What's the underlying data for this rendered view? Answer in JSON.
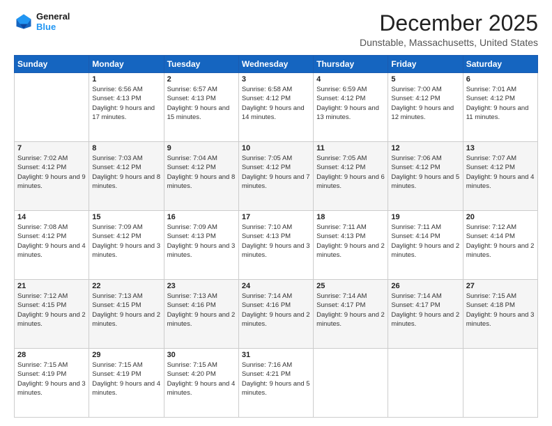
{
  "logo": {
    "line1": "General",
    "line2": "Blue"
  },
  "title": "December 2025",
  "location": "Dunstable, Massachusetts, United States",
  "header": {
    "days": [
      "Sunday",
      "Monday",
      "Tuesday",
      "Wednesday",
      "Thursday",
      "Friday",
      "Saturday"
    ]
  },
  "weeks": [
    [
      {
        "day": "",
        "sunrise": "",
        "sunset": "",
        "daylight": ""
      },
      {
        "day": "1",
        "sunrise": "Sunrise: 6:56 AM",
        "sunset": "Sunset: 4:13 PM",
        "daylight": "Daylight: 9 hours and 17 minutes."
      },
      {
        "day": "2",
        "sunrise": "Sunrise: 6:57 AM",
        "sunset": "Sunset: 4:13 PM",
        "daylight": "Daylight: 9 hours and 15 minutes."
      },
      {
        "day": "3",
        "sunrise": "Sunrise: 6:58 AM",
        "sunset": "Sunset: 4:12 PM",
        "daylight": "Daylight: 9 hours and 14 minutes."
      },
      {
        "day": "4",
        "sunrise": "Sunrise: 6:59 AM",
        "sunset": "Sunset: 4:12 PM",
        "daylight": "Daylight: 9 hours and 13 minutes."
      },
      {
        "day": "5",
        "sunrise": "Sunrise: 7:00 AM",
        "sunset": "Sunset: 4:12 PM",
        "daylight": "Daylight: 9 hours and 12 minutes."
      },
      {
        "day": "6",
        "sunrise": "Sunrise: 7:01 AM",
        "sunset": "Sunset: 4:12 PM",
        "daylight": "Daylight: 9 hours and 11 minutes."
      }
    ],
    [
      {
        "day": "7",
        "sunrise": "Sunrise: 7:02 AM",
        "sunset": "Sunset: 4:12 PM",
        "daylight": "Daylight: 9 hours and 9 minutes."
      },
      {
        "day": "8",
        "sunrise": "Sunrise: 7:03 AM",
        "sunset": "Sunset: 4:12 PM",
        "daylight": "Daylight: 9 hours and 8 minutes."
      },
      {
        "day": "9",
        "sunrise": "Sunrise: 7:04 AM",
        "sunset": "Sunset: 4:12 PM",
        "daylight": "Daylight: 9 hours and 8 minutes."
      },
      {
        "day": "10",
        "sunrise": "Sunrise: 7:05 AM",
        "sunset": "Sunset: 4:12 PM",
        "daylight": "Daylight: 9 hours and 7 minutes."
      },
      {
        "day": "11",
        "sunrise": "Sunrise: 7:05 AM",
        "sunset": "Sunset: 4:12 PM",
        "daylight": "Daylight: 9 hours and 6 minutes."
      },
      {
        "day": "12",
        "sunrise": "Sunrise: 7:06 AM",
        "sunset": "Sunset: 4:12 PM",
        "daylight": "Daylight: 9 hours and 5 minutes."
      },
      {
        "day": "13",
        "sunrise": "Sunrise: 7:07 AM",
        "sunset": "Sunset: 4:12 PM",
        "daylight": "Daylight: 9 hours and 4 minutes."
      }
    ],
    [
      {
        "day": "14",
        "sunrise": "Sunrise: 7:08 AM",
        "sunset": "Sunset: 4:12 PM",
        "daylight": "Daylight: 9 hours and 4 minutes."
      },
      {
        "day": "15",
        "sunrise": "Sunrise: 7:09 AM",
        "sunset": "Sunset: 4:12 PM",
        "daylight": "Daylight: 9 hours and 3 minutes."
      },
      {
        "day": "16",
        "sunrise": "Sunrise: 7:09 AM",
        "sunset": "Sunset: 4:13 PM",
        "daylight": "Daylight: 9 hours and 3 minutes."
      },
      {
        "day": "17",
        "sunrise": "Sunrise: 7:10 AM",
        "sunset": "Sunset: 4:13 PM",
        "daylight": "Daylight: 9 hours and 3 minutes."
      },
      {
        "day": "18",
        "sunrise": "Sunrise: 7:11 AM",
        "sunset": "Sunset: 4:13 PM",
        "daylight": "Daylight: 9 hours and 2 minutes."
      },
      {
        "day": "19",
        "sunrise": "Sunrise: 7:11 AM",
        "sunset": "Sunset: 4:14 PM",
        "daylight": "Daylight: 9 hours and 2 minutes."
      },
      {
        "day": "20",
        "sunrise": "Sunrise: 7:12 AM",
        "sunset": "Sunset: 4:14 PM",
        "daylight": "Daylight: 9 hours and 2 minutes."
      }
    ],
    [
      {
        "day": "21",
        "sunrise": "Sunrise: 7:12 AM",
        "sunset": "Sunset: 4:15 PM",
        "daylight": "Daylight: 9 hours and 2 minutes."
      },
      {
        "day": "22",
        "sunrise": "Sunrise: 7:13 AM",
        "sunset": "Sunset: 4:15 PM",
        "daylight": "Daylight: 9 hours and 2 minutes."
      },
      {
        "day": "23",
        "sunrise": "Sunrise: 7:13 AM",
        "sunset": "Sunset: 4:16 PM",
        "daylight": "Daylight: 9 hours and 2 minutes."
      },
      {
        "day": "24",
        "sunrise": "Sunrise: 7:14 AM",
        "sunset": "Sunset: 4:16 PM",
        "daylight": "Daylight: 9 hours and 2 minutes."
      },
      {
        "day": "25",
        "sunrise": "Sunrise: 7:14 AM",
        "sunset": "Sunset: 4:17 PM",
        "daylight": "Daylight: 9 hours and 2 minutes."
      },
      {
        "day": "26",
        "sunrise": "Sunrise: 7:14 AM",
        "sunset": "Sunset: 4:17 PM",
        "daylight": "Daylight: 9 hours and 2 minutes."
      },
      {
        "day": "27",
        "sunrise": "Sunrise: 7:15 AM",
        "sunset": "Sunset: 4:18 PM",
        "daylight": "Daylight: 9 hours and 3 minutes."
      }
    ],
    [
      {
        "day": "28",
        "sunrise": "Sunrise: 7:15 AM",
        "sunset": "Sunset: 4:19 PM",
        "daylight": "Daylight: 9 hours and 3 minutes."
      },
      {
        "day": "29",
        "sunrise": "Sunrise: 7:15 AM",
        "sunset": "Sunset: 4:19 PM",
        "daylight": "Daylight: 9 hours and 4 minutes."
      },
      {
        "day": "30",
        "sunrise": "Sunrise: 7:15 AM",
        "sunset": "Sunset: 4:20 PM",
        "daylight": "Daylight: 9 hours and 4 minutes."
      },
      {
        "day": "31",
        "sunrise": "Sunrise: 7:16 AM",
        "sunset": "Sunset: 4:21 PM",
        "daylight": "Daylight: 9 hours and 5 minutes."
      },
      {
        "day": "",
        "sunrise": "",
        "sunset": "",
        "daylight": ""
      },
      {
        "day": "",
        "sunrise": "",
        "sunset": "",
        "daylight": ""
      },
      {
        "day": "",
        "sunrise": "",
        "sunset": "",
        "daylight": ""
      }
    ]
  ]
}
